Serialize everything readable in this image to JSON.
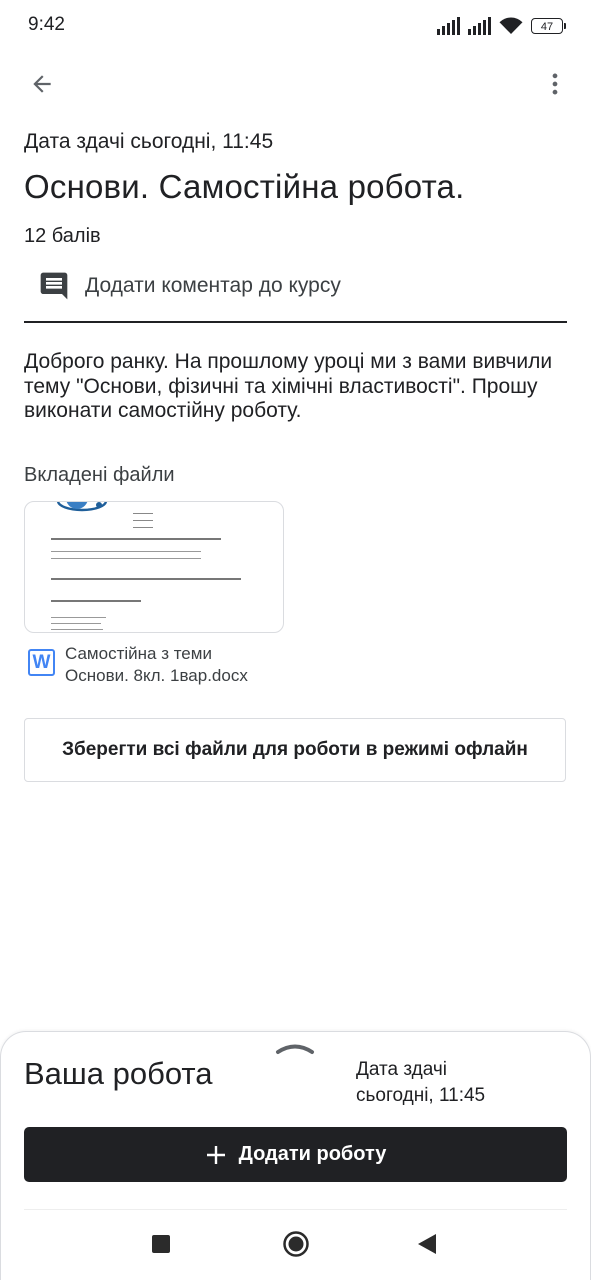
{
  "status_bar": {
    "time": "9:42",
    "battery": "47"
  },
  "assignment": {
    "due": "Дата здачі сьогодні, 11:45",
    "title": "Основи. Самостійна робота.",
    "points": "12 балів",
    "add_comment": "Додати коментар до курсу",
    "description": "Доброго ранку. На прошлому уроці ми з вами вивчили тему \"Основи, фізичні та хімічні властивості\". Прошу виконати самостійну роботу.",
    "attachments_heading": "Вкладені файли",
    "attachment": {
      "icon": "W",
      "name_line1": "Самостійна з теми",
      "name_line2": "Основи. 8кл. 1вар.docx"
    },
    "save_offline": "Зберегти всі файли для роботи в режимі офлайн"
  },
  "your_work": {
    "title": "Ваша робота",
    "due_line1": "Дата здачі",
    "due_line2": "сьогодні, 11:45",
    "add_button": "Додати роботу"
  },
  "icons": {
    "back": "arrow-back-icon",
    "more": "more-vert-icon",
    "comment": "comment-icon",
    "add": "plus-icon"
  },
  "colors": {
    "primary_dark": "#202124",
    "word_blue": "#4285f4"
  }
}
